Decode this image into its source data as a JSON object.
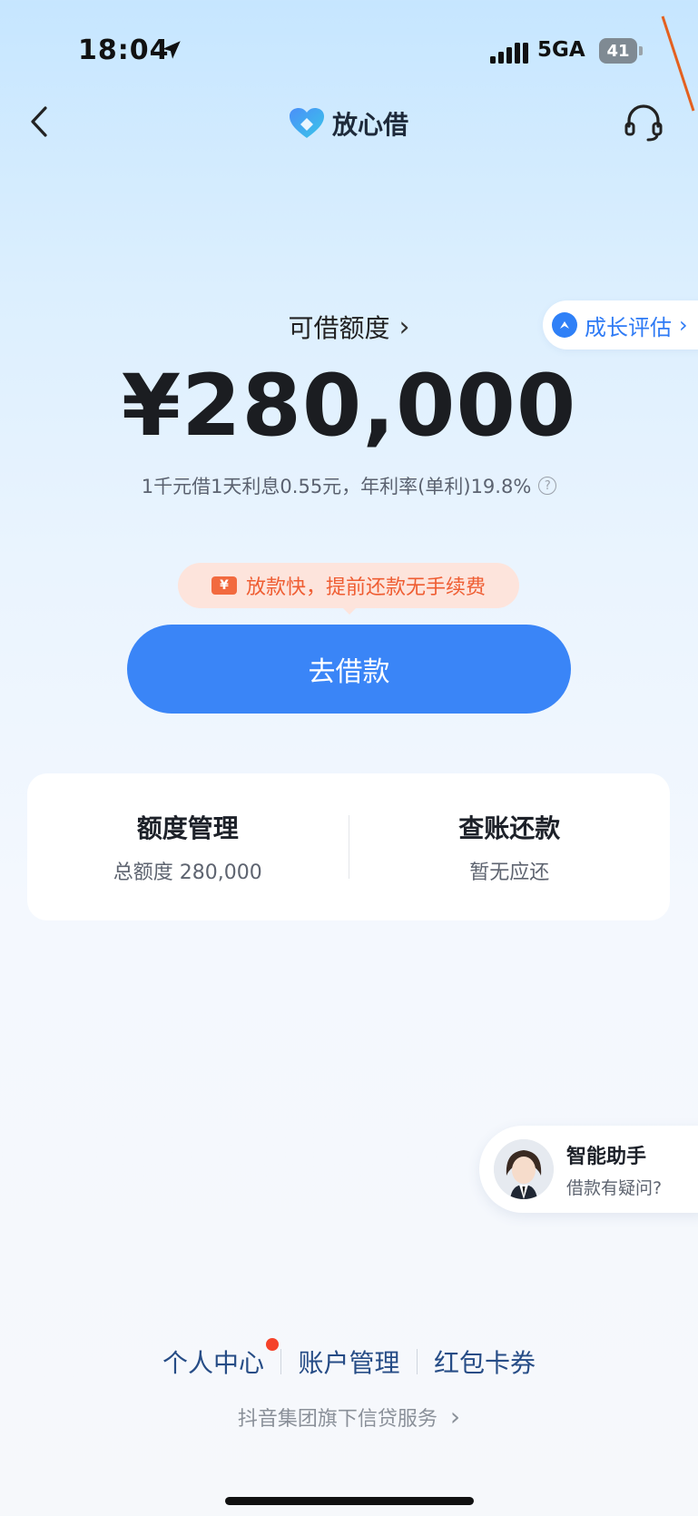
{
  "status_bar": {
    "time": "18:04",
    "network": "5GA",
    "battery": "41"
  },
  "nav": {
    "brand": "放心借"
  },
  "growth_badge": {
    "label": "成长评估"
  },
  "credit": {
    "title": "可借额度",
    "amount": "¥280,000",
    "rate_text": "1千元借1天利息0.55元，年利率(单利)19.8%"
  },
  "promo": {
    "icon_text": "¥",
    "text": "放款快，提前还款无手续费"
  },
  "borrow_button": {
    "label": "去借款"
  },
  "card": {
    "left": {
      "title": "额度管理",
      "subtitle": "总额度 280,000"
    },
    "right": {
      "title": "查账还款",
      "subtitle": "暂无应还"
    }
  },
  "assistant": {
    "title": "智能助手",
    "subtitle": "借款有疑问?"
  },
  "footer": {
    "links": [
      "个人中心",
      "账户管理",
      "红包卡券"
    ],
    "service_text": "抖音集团旗下信贷服务"
  },
  "colors": {
    "accent": "#3a85f7",
    "promo": "#ef5d32",
    "link": "#264c86"
  }
}
